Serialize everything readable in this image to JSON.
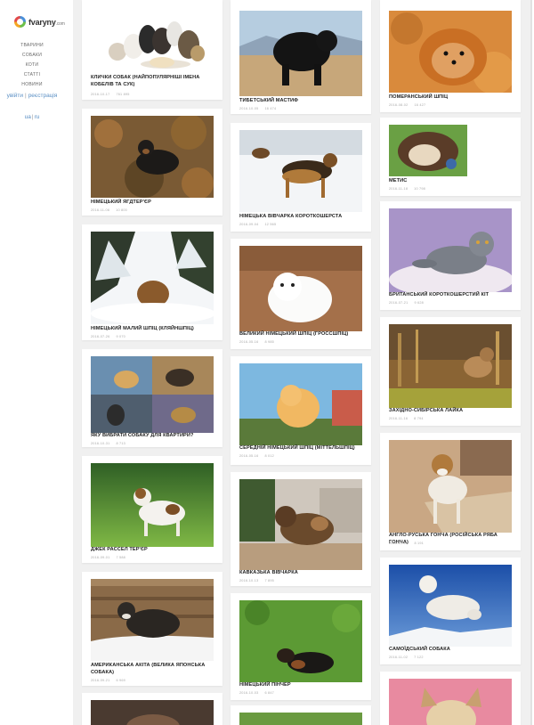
{
  "site": {
    "logo_text": "fvaryny",
    "logo_suffix": ".com"
  },
  "nav": [
    {
      "label": "ТВАРИНИ"
    },
    {
      "label": "СОБАКИ"
    },
    {
      "label": "КОТИ"
    },
    {
      "label": "СТАТТІ"
    },
    {
      "label": "НОВИНИ"
    }
  ],
  "auth": {
    "login": "увійти",
    "separator": "|",
    "register": "реєстрація"
  },
  "lang": {
    "uk": "ua",
    "separator": "|",
    "ru": "ru"
  },
  "cards": [
    {
      "title": "Клички собак (найпопулярніші імена кобелів та сук)",
      "date": "2016-10-17",
      "views": "761 895"
    },
    {
      "title": "Німецький ягдтер'єр",
      "date": "2016-11-06",
      "views": "10 800"
    },
    {
      "title": "Німецький малий шпіц (кляйншпіц)",
      "date": "2016-07-26",
      "views": "9 070"
    },
    {
      "title": "Яку вибрати собаку для квартири?",
      "date": "2016-10-31",
      "views": "8 713"
    },
    {
      "title": "Джек Рассел тер'єр",
      "date": "2016-09-01",
      "views": "7 588"
    },
    {
      "title": "Американська акіта (велика японська собака)",
      "date": "2016-09-21",
      "views": "6 969"
    },
    {
      "title": "Тибетський мастиф",
      "date": "2016-10-05",
      "views": "16 474"
    },
    {
      "title": "Німецька вівчарка короткошерста",
      "date": "2016-09-04",
      "views": "12 565"
    },
    {
      "title": "Великий німецький шпіц (гроссшпіц)",
      "date": "2016-05-16",
      "views": "8 985"
    },
    {
      "title": "Середній німецький шпіц (міттельшпіц)",
      "date": "2016-05-16",
      "views": "8 012"
    },
    {
      "title": "Кавказька вівчарка",
      "date": "2016-10-13",
      "views": "7 895"
    },
    {
      "title": "Німецький пінчер",
      "date": "2016-10-03",
      "views": "6 847"
    },
    {
      "title": "Померанський шпіц",
      "date": "2016-08-02",
      "views": "16 427"
    },
    {
      "title": "Метис",
      "date": "2016-11-18",
      "views": "10 798"
    },
    {
      "title": "Британський короткошерстий кіт",
      "date": "2016-07-21",
      "views": "9 628"
    },
    {
      "title": "Західно-сибірська лайка",
      "date": "2016-11-16",
      "views": "8 794"
    },
    {
      "title": "Англо-руська гонча (російська ряба гонча)",
      "date": "2016-10-12",
      "views": "8 191"
    },
    {
      "title": "Самоїдський собака",
      "date": "2016-11-02",
      "views": "7 122"
    }
  ]
}
